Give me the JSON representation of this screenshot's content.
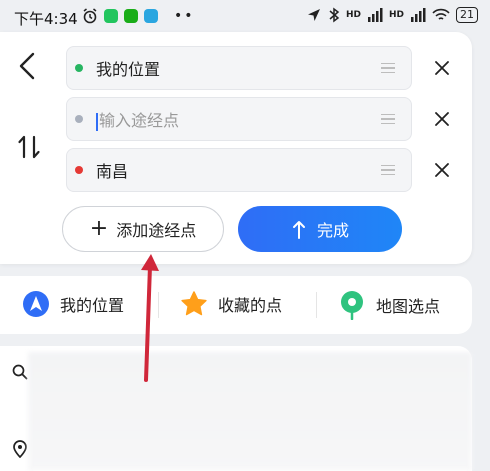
{
  "status_bar": {
    "time": "下午4:34",
    "signal1": "HD",
    "signal2": "HD",
    "battery": "21"
  },
  "route": {
    "start": "我的位置",
    "waypoint_placeholder": "输入途经点",
    "destination": "南昌",
    "add_stop_label": "添加途经点",
    "done_label": "完成"
  },
  "quick": {
    "my_location": "我的位置",
    "favorites": "收藏的点",
    "pick_on_map": "地图选点"
  },
  "colors": {
    "start_dot": "#27b562",
    "waypoint_dot": "#a9b0bd",
    "destination_dot": "#e53935",
    "accent": "#2f6df6",
    "annotation_arrow": "#d0273a"
  }
}
